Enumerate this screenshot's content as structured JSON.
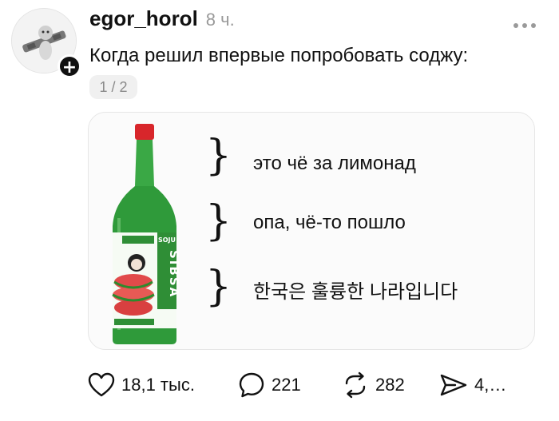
{
  "author": {
    "username": "egor_horol",
    "time_ago": "8 ч."
  },
  "post": {
    "text": "Когда решил впервые попробовать соджу:",
    "pager": "1 / 2"
  },
  "media": {
    "captions": [
      "это чё за лимонад",
      "опа, чё-то пошло",
      "한국은 훌륭한 나라입니다"
    ],
    "bottle_label": "SIBSA",
    "bottle_tag": "SOJU",
    "brace_char": "}"
  },
  "actions": {
    "likes": "18,1 тыс.",
    "replies": "221",
    "reposts": "282",
    "shares": "4,…"
  },
  "icons": [
    "plus-icon",
    "more-dots-icon",
    "heart-icon",
    "comment-icon",
    "repost-icon",
    "send-icon"
  ],
  "colors": {
    "bottle_green": "#2f9a3a",
    "cap_red": "#d8262b",
    "badge_black": "#111111"
  }
}
